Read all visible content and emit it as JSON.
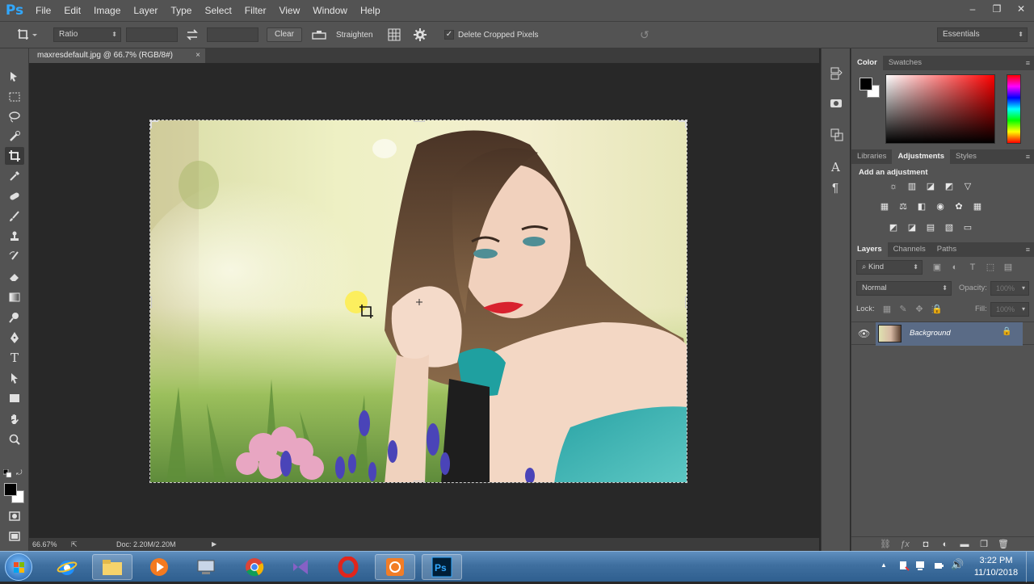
{
  "menubar": {
    "logo": "Ps",
    "items": [
      "File",
      "Edit",
      "Image",
      "Layer",
      "Type",
      "Select",
      "Filter",
      "View",
      "Window",
      "Help"
    ],
    "window_controls": [
      "‒",
      "❐",
      "✕"
    ]
  },
  "options": {
    "ratio_value": "Ratio",
    "clear_label": "Clear",
    "straighten_label": "Straighten",
    "delete_cropped_label": "Delete Cropped Pixels",
    "delete_cropped_checked": true,
    "workspace_value": "Essentials"
  },
  "document": {
    "tab_title": "maxresdefault.jpg @ 66.7% (RGB/8#)",
    "tab_close": "×",
    "zoom": "66.67%",
    "doc_info": "Doc: 2.20M/2.20M"
  },
  "panels": {
    "color_tabs": [
      "Color",
      "Swatches"
    ],
    "adjust_tabs": [
      "Libraries",
      "Adjustments",
      "Styles"
    ],
    "adjust_heading": "Add an adjustment",
    "layers_tabs": [
      "Layers",
      "Channels",
      "Paths"
    ],
    "kind_label": "Kind",
    "blend_mode": "Normal",
    "opacity_label": "Opacity:",
    "opacity_value": "100%",
    "lock_label": "Lock:",
    "fill_label": "Fill:",
    "fill_value": "100%",
    "layer_name": "Background"
  },
  "taskbar": {
    "time": "3:22 PM",
    "date": "11/10/2018"
  },
  "colors": {
    "ui_bg": "#535353",
    "canvas_bg": "#282828",
    "layer_selected": "#5a6b86",
    "foreground": "#000000",
    "background": "#ffffff"
  }
}
